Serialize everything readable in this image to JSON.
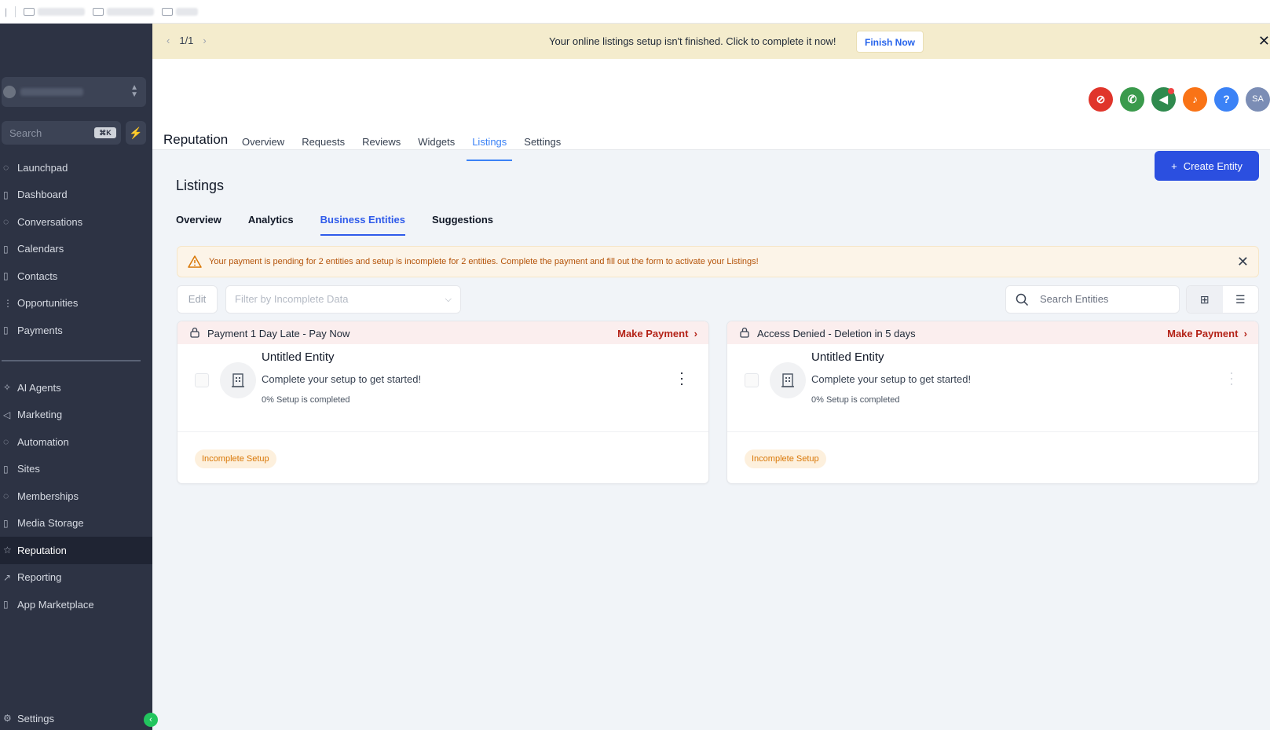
{
  "bookmarks": {
    "separator": "|"
  },
  "sidebar": {
    "search_placeholder": "Search",
    "search_shortcut": "⌘K",
    "items_top": [
      {
        "label": "Launchpad",
        "icon": "rocket-icon"
      },
      {
        "label": "Dashboard",
        "icon": "dashboard-icon"
      },
      {
        "label": "Conversations",
        "icon": "chat-icon"
      },
      {
        "label": "Calendars",
        "icon": "calendar-icon"
      },
      {
        "label": "Contacts",
        "icon": "contacts-icon"
      },
      {
        "label": "Opportunities",
        "icon": "funnel-icon"
      },
      {
        "label": "Payments",
        "icon": "payments-icon"
      }
    ],
    "items_bottom": [
      {
        "label": "AI Agents",
        "icon": "sparkle-icon"
      },
      {
        "label": "Marketing",
        "icon": "megaphone-icon"
      },
      {
        "label": "Automation",
        "icon": "automation-icon"
      },
      {
        "label": "Sites",
        "icon": "sites-icon"
      },
      {
        "label": "Memberships",
        "icon": "membership-icon"
      },
      {
        "label": "Media Storage",
        "icon": "media-icon"
      },
      {
        "label": "Reputation",
        "icon": "star-icon",
        "active": true
      },
      {
        "label": "Reporting",
        "icon": "chart-icon"
      },
      {
        "label": "App Marketplace",
        "icon": "marketplace-icon"
      }
    ],
    "settings_label": "Settings"
  },
  "banner": {
    "pager": "1/1",
    "message": "Your online listings setup isn't finished. Click to complete it now!",
    "button": "Finish Now"
  },
  "header": {
    "title": "Reputation",
    "tabs": [
      "Overview",
      "Requests",
      "Reviews",
      "Widgets",
      "Listings",
      "Settings"
    ],
    "active_tab": "Listings",
    "avatar_initials": "SA",
    "help_glyph": "?",
    "colors": {
      "red": "#e0352b",
      "green": "#3a9a4c",
      "darkgreen": "#2f8a4e",
      "orange": "#f97316",
      "blue": "#3b82f6",
      "slate": "#7b8db5"
    }
  },
  "page": {
    "title": "Listings",
    "create_button": "Create Entity",
    "sub_tabs": [
      "Overview",
      "Analytics",
      "Business Entities",
      "Suggestions"
    ],
    "active_sub_tab": "Business Entities",
    "warning": "Your payment is pending for 2 entities and setup is incomplete for 2 entities. Complete the payment and fill out the form to activate your Listings!",
    "edit_button": "Edit",
    "filter_placeholder": "Filter by Incomplete Data",
    "search_placeholder": "Search Entities"
  },
  "cards": [
    {
      "status": "Payment 1 Day Late - Pay Now",
      "action": "Make Payment",
      "name": "Untitled Entity",
      "description": "Complete your setup to get started!",
      "progress_text": "0% Setup is completed",
      "badge": "Incomplete Setup"
    },
    {
      "status": "Access Denied - Deletion in 5 days",
      "action": "Make Payment",
      "name": "Untitled Entity",
      "description": "Complete your setup to get started!",
      "progress_text": "0% Setup is completed",
      "badge": "Incomplete Setup"
    }
  ]
}
